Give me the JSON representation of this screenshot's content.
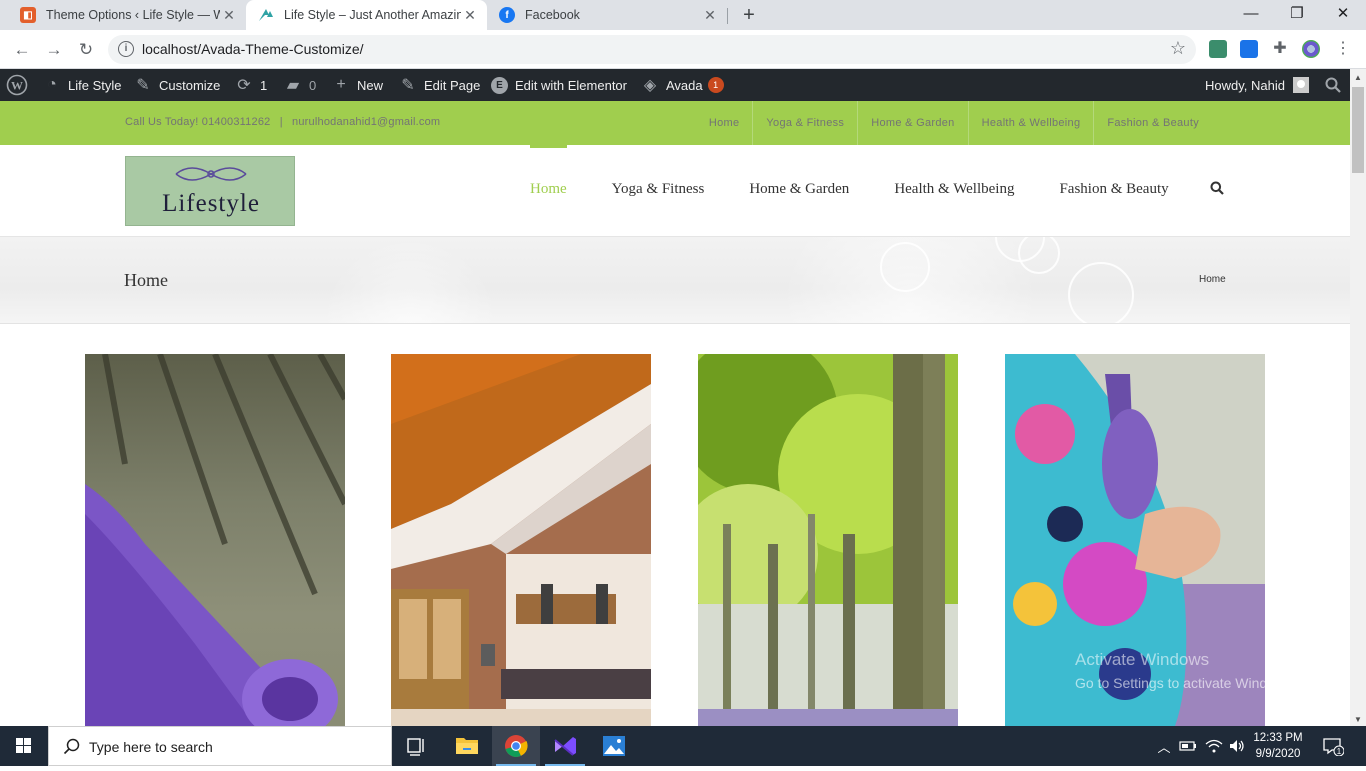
{
  "browser": {
    "tabs": [
      {
        "title": "Theme Options ‹ Life Style — Wo",
        "favicon": "avada-icon",
        "color": "#e35f2c"
      },
      {
        "title": "Life Style – Just Another Amazing",
        "favicon": "avada-logo-icon",
        "color": "#2fa3a5"
      },
      {
        "title": "Facebook",
        "favicon": "facebook-icon",
        "color": "#1877f2"
      }
    ],
    "url": "localhost/Avada-Theme-Customize/"
  },
  "adminbar": {
    "site_name": "Life Style",
    "customize": "Customize",
    "updates_count": "1",
    "comments_count": "0",
    "new_label": "New",
    "edit_page": "Edit Page",
    "edit_elementor": "Edit with Elementor",
    "avada_label": "Avada",
    "avada_badge": "1",
    "howdy": "Howdy, Nahid"
  },
  "topbar": {
    "phone": "Call Us Today! 01400311262",
    "separator": "|",
    "email": "nurulhodanahid1@gmail.com",
    "nav": [
      "Home",
      "Yoga & Fitness",
      "Home & Garden",
      "Health & Wellbeing",
      "Fashion & Beauty"
    ]
  },
  "header": {
    "logo_text": "Lifestyle",
    "nav": [
      "Home",
      "Yoga & Fitness",
      "Home & Garden",
      "Health & Wellbeing",
      "Fashion & Beauty"
    ],
    "active_index": 0
  },
  "page_title": {
    "title": "Home",
    "breadcrumb": "Home"
  },
  "watermark": {
    "line1": "Activate Windows",
    "line2": "Go to Settings to activate Windows."
  },
  "taskbar": {
    "search_placeholder": "Type here to search",
    "time": "12:33 PM",
    "date": "9/9/2020",
    "notification_count": "1"
  },
  "colors": {
    "accent_green": "#a0ce4e",
    "adminbar_bg": "#23282d",
    "taskbar_bg": "#1f2a38"
  }
}
